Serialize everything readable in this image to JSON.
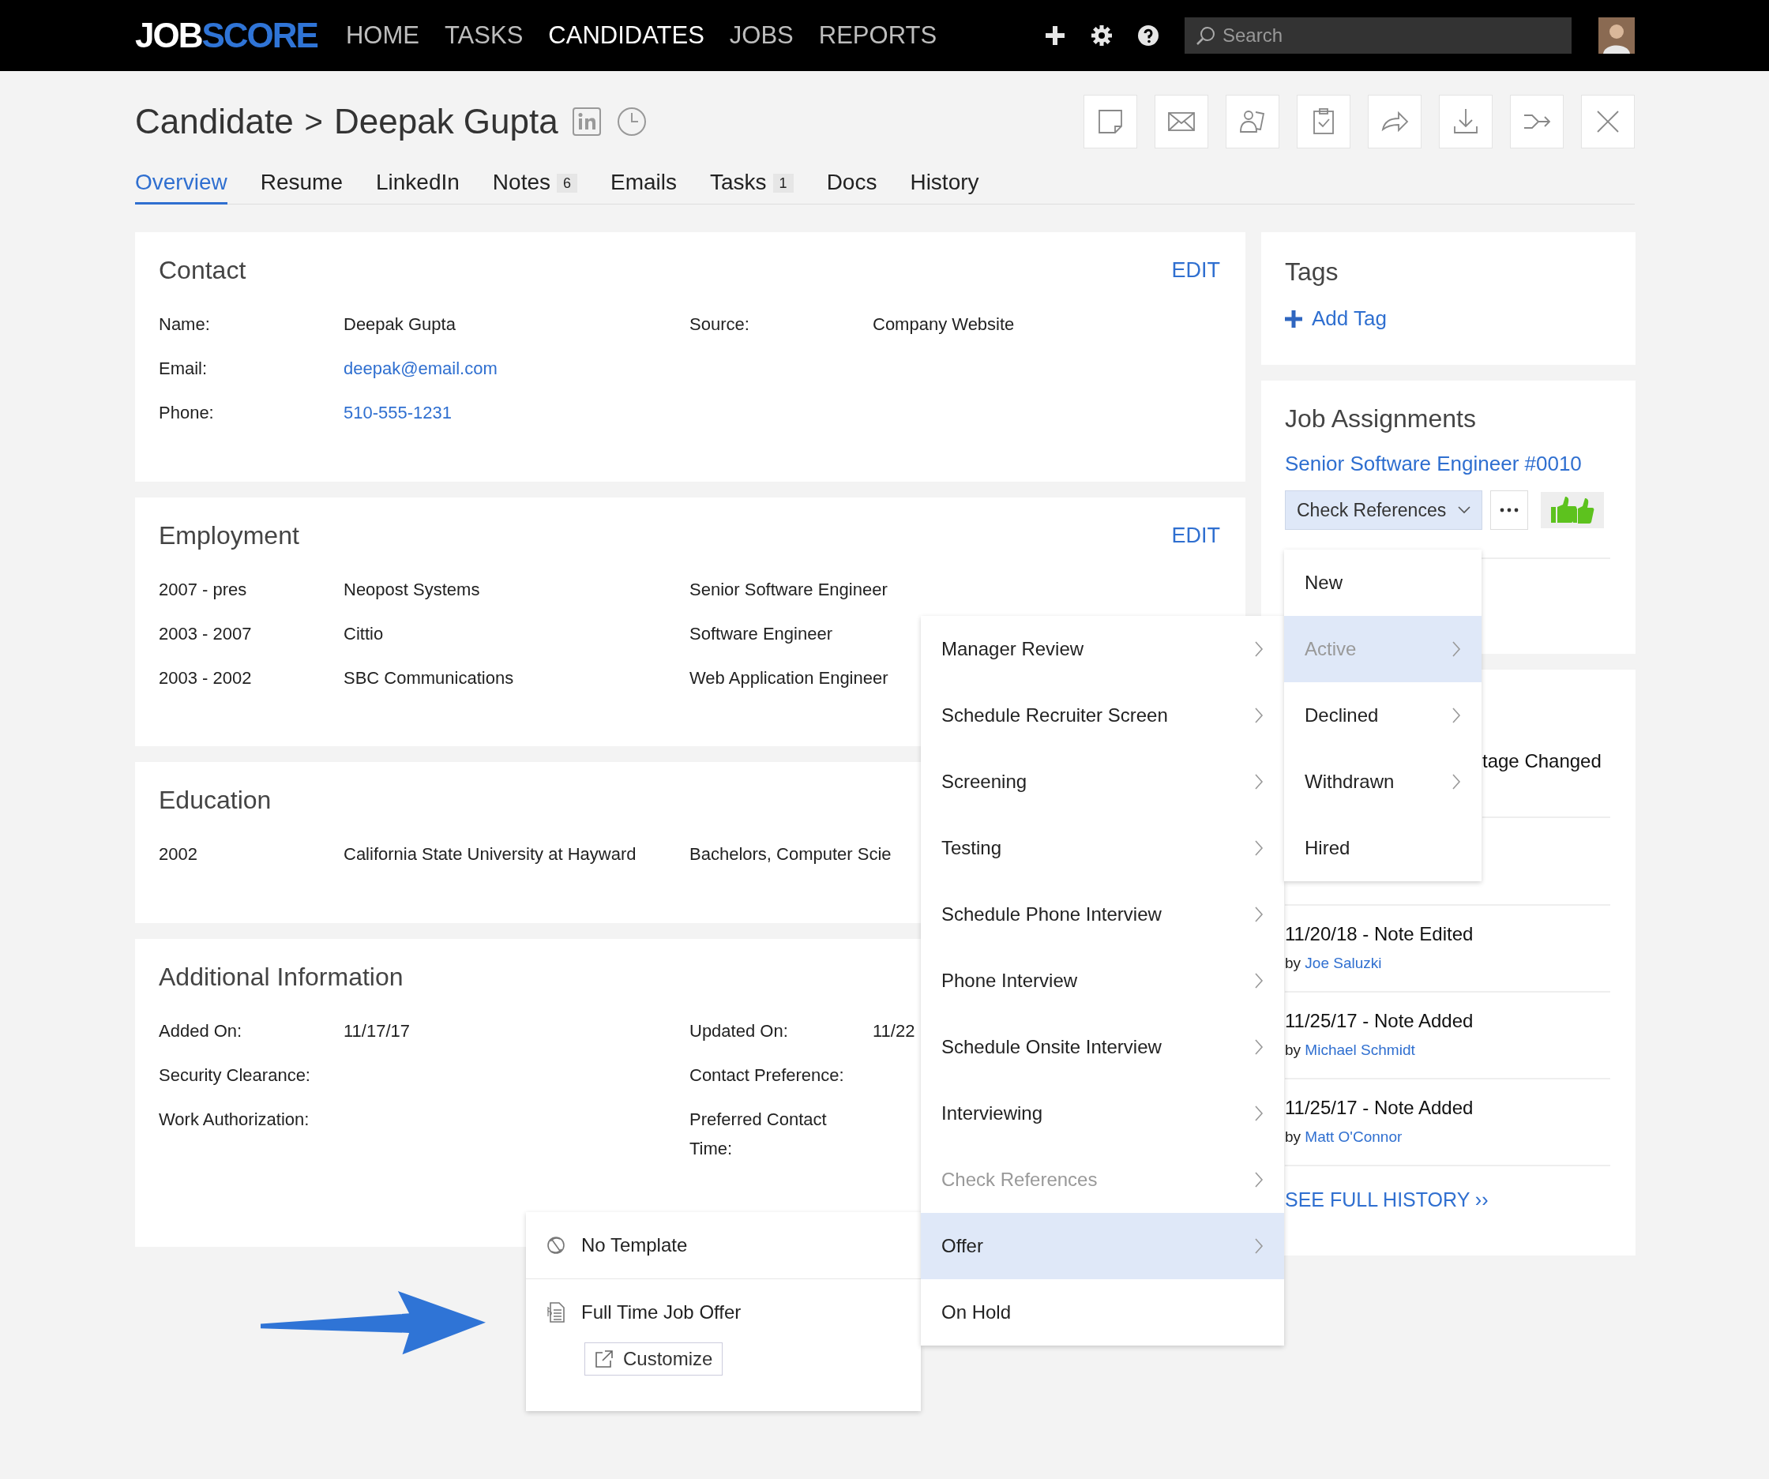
{
  "topbar": {
    "logo": [
      "JOB",
      "SCORE"
    ],
    "nav": [
      {
        "label": "HOME",
        "selected": false
      },
      {
        "label": "TASKS",
        "selected": false
      },
      {
        "label": "CANDIDATES",
        "selected": true
      },
      {
        "label": "JOBS",
        "selected": false
      },
      {
        "label": "REPORTS",
        "selected": false
      }
    ],
    "search": {
      "placeholder": "Search"
    }
  },
  "header": {
    "breadcrumb": "Candidate",
    "separator": ">",
    "name": "Deepak Gupta"
  },
  "tabs": [
    {
      "label": "Overview",
      "selected": true
    },
    {
      "label": "Resume",
      "selected": false
    },
    {
      "label": "LinkedIn",
      "selected": false
    },
    {
      "label": "Notes",
      "count": "6",
      "selected": false
    },
    {
      "label": "Emails",
      "selected": false
    },
    {
      "label": "Tasks",
      "count": "1",
      "selected": false
    },
    {
      "label": "Docs",
      "selected": false
    },
    {
      "label": "History",
      "selected": false
    }
  ],
  "sections": [
    {
      "title": "Contact",
      "edit": "EDIT",
      "kind": "pairs",
      "rows": [
        [
          {
            "label": "Name:",
            "value": "Deepak Gupta",
            "link": false
          },
          {
            "label": "Source:",
            "value": "Company Website",
            "link": false
          }
        ],
        [
          {
            "label": "Email:",
            "value": "deepak@email.com",
            "link": true
          }
        ],
        [
          {
            "label": "Phone:",
            "value": "510-555-1231",
            "link": true
          }
        ]
      ]
    },
    {
      "title": "Employment",
      "edit": "EDIT",
      "kind": "list",
      "rows": [
        [
          "2007 - pres",
          "Neopost Systems",
          "Senior Software Engineer"
        ],
        [
          "2003 - 2007",
          "Cittio",
          "Software Engineer"
        ],
        [
          "2003 - 2002",
          "SBC Communications",
          "Web Application Engineer"
        ]
      ]
    },
    {
      "title": "Education",
      "kind": "list",
      "rows": [
        [
          "2002",
          "California State University at Hayward",
          "Bachelors, Computer Scie"
        ]
      ]
    },
    {
      "title": "Additional Information",
      "kind": "pairs",
      "rows": [
        [
          {
            "label": "Added On:",
            "value": "11/17/17",
            "link": false
          },
          {
            "label": "Updated On:",
            "value": "11/22",
            "link": false
          }
        ],
        [
          {
            "label": "Security Clearance:"
          },
          {
            "label": "Contact Preference:"
          }
        ],
        [
          {
            "label": "Work Authorization:"
          },
          {
            "label": "Preferred Contact Time:"
          }
        ]
      ]
    }
  ],
  "tags": {
    "title": "Tags",
    "add": "Add Tag"
  },
  "job_assignments": {
    "title": "Job Assignments",
    "job": "Senior Software Engineer #0010",
    "stage": "Check References"
  },
  "history": {
    "items": [
      {
        "title": "tage Changed"
      },
      {
        "title": "11/20/18 - Note Edited",
        "by": "by",
        "author": "Joe Saluzki"
      },
      {
        "title": "11/25/17 - Note Added",
        "by": "by",
        "author": "Michael Schmidt"
      },
      {
        "title": "11/25/17 - Note Added",
        "by": "by",
        "author": "Matt O'Connor"
      }
    ],
    "see_all": "SEE FULL HISTORY ››"
  },
  "stage_menu": [
    {
      "label": "New",
      "selected": false,
      "current": false,
      "has_submenu": false
    },
    {
      "label": "Active",
      "selected": true,
      "current": true,
      "has_submenu": true
    },
    {
      "label": "Declined",
      "selected": false,
      "current": false,
      "has_submenu": true
    },
    {
      "label": "Withdrawn",
      "selected": false,
      "current": false,
      "has_submenu": true
    },
    {
      "label": "Hired",
      "selected": false,
      "current": false,
      "has_submenu": false
    }
  ],
  "stage_submenu": [
    {
      "label": "Manager Review",
      "selected": false,
      "current": false,
      "has_submenu": true
    },
    {
      "label": "Schedule Recruiter Screen",
      "selected": false,
      "current": false,
      "has_submenu": true
    },
    {
      "label": "Screening",
      "selected": false,
      "current": false,
      "has_submenu": true
    },
    {
      "label": "Testing",
      "selected": false,
      "current": false,
      "has_submenu": true
    },
    {
      "label": "Schedule Phone Interview",
      "selected": false,
      "current": false,
      "has_submenu": true
    },
    {
      "label": "Phone Interview",
      "selected": false,
      "current": false,
      "has_submenu": true
    },
    {
      "label": "Schedule Onsite Interview",
      "selected": false,
      "current": false,
      "has_submenu": true
    },
    {
      "label": "Interviewing",
      "selected": false,
      "current": false,
      "has_submenu": true
    },
    {
      "label": "Check References",
      "selected": false,
      "current": true,
      "has_submenu": true
    },
    {
      "label": "Offer",
      "selected": true,
      "current": false,
      "has_submenu": true
    },
    {
      "label": "On Hold",
      "selected": false,
      "current": false,
      "has_submenu": false
    }
  ],
  "template_menu": [
    {
      "label": "No Template",
      "kind": "none"
    },
    {
      "label": "Full Time Job Offer",
      "kind": "document",
      "action": "Customize"
    }
  ]
}
